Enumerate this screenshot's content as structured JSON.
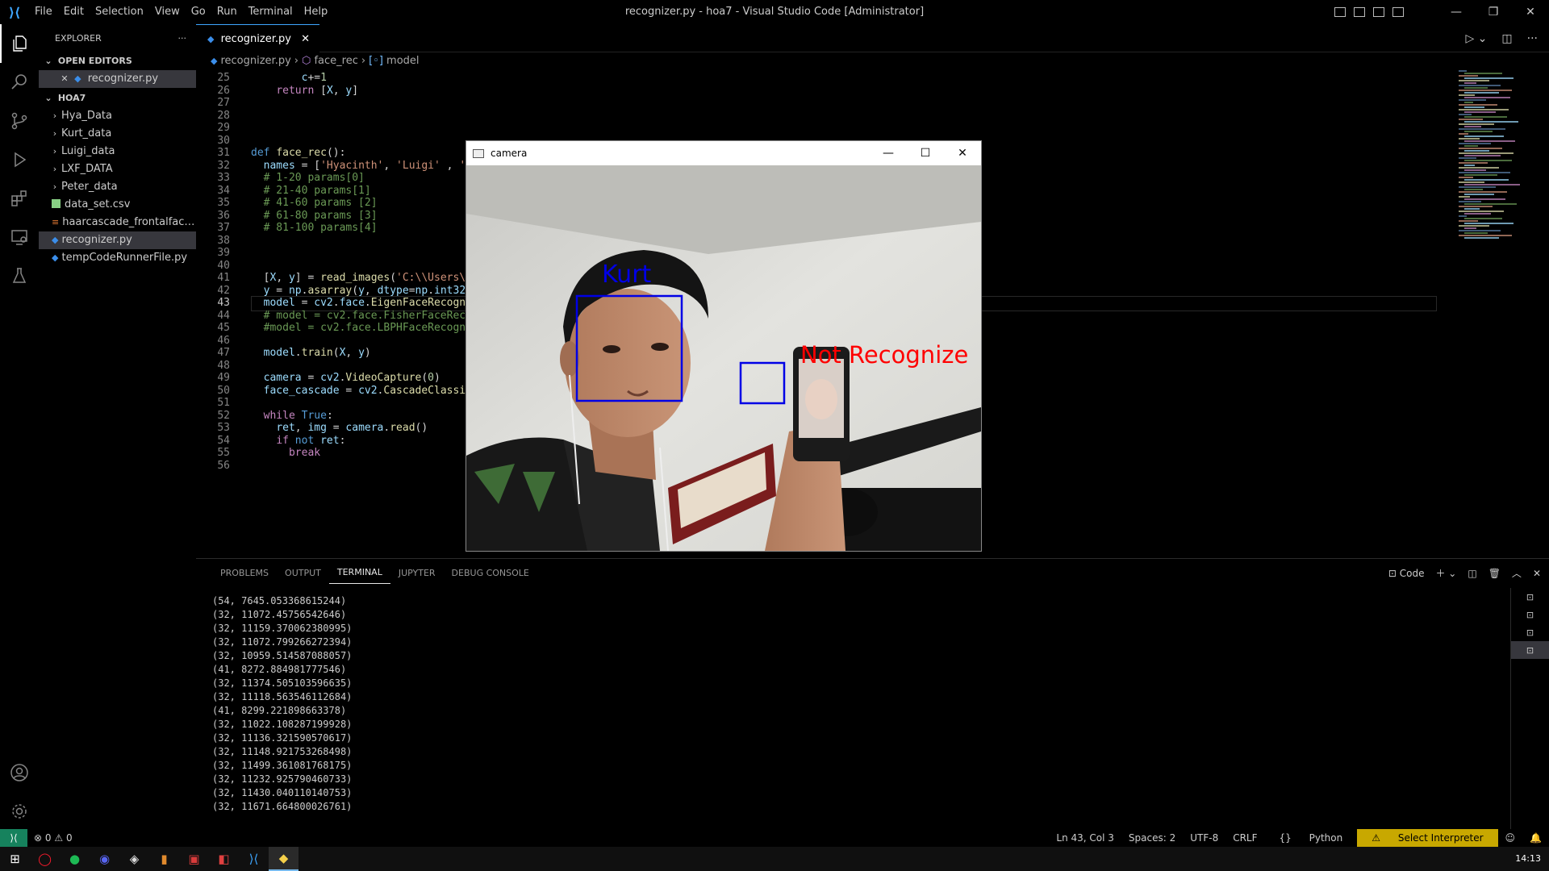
{
  "titlebar": {
    "menu": [
      "File",
      "Edit",
      "Selection",
      "View",
      "Go",
      "Run",
      "Terminal",
      "Help"
    ],
    "title": "recognizer.py - hoa7 - Visual Studio Code [Administrator]"
  },
  "explorer": {
    "header": "EXPLORER",
    "open_editors_label": "OPEN EDITORS",
    "open_editor_file": "recognizer.py",
    "folder_label": "HOA7",
    "folders": [
      "Hya_Data",
      "Kurt_data",
      "Luigi_data",
      "LXF_DATA",
      "Peter_data"
    ],
    "files": [
      "data_set.csv",
      "haarcascade_frontalface_...",
      "recognizer.py",
      "tempCodeRunnerFile.py"
    ]
  },
  "editor": {
    "tab_label": "recognizer.py",
    "breadcrumb": [
      "recognizer.py",
      "face_rec",
      "model"
    ],
    "lines": [
      {
        "n": "25",
        "text": "        c+=1"
      },
      {
        "n": "26",
        "text": "    return [X, y]"
      },
      {
        "n": "27",
        "text": ""
      },
      {
        "n": "28",
        "text": ""
      },
      {
        "n": "29",
        "text": ""
      },
      {
        "n": "30",
        "text": ""
      },
      {
        "n": "31",
        "text": "def face_rec():"
      },
      {
        "n": "32",
        "text": "  names = ['Hyacinth', 'Luigi' , 'K"
      },
      {
        "n": "33",
        "text": "  # 1-20 params[0]"
      },
      {
        "n": "34",
        "text": "  # 21-40 params[1]"
      },
      {
        "n": "35",
        "text": "  # 41-60 params [2]"
      },
      {
        "n": "36",
        "text": "  # 61-80 params [3]"
      },
      {
        "n": "37",
        "text": "  # 81-100 params[4]"
      },
      {
        "n": "38",
        "text": ""
      },
      {
        "n": "39",
        "text": ""
      },
      {
        "n": "40",
        "text": ""
      },
      {
        "n": "41",
        "text": "  [X, y] = read_images('C:\\\\Users\\\\"
      },
      {
        "n": "42",
        "text": "  y = np.asarray(y, dtype=np.int32)"
      },
      {
        "n": "43",
        "text": "  model = cv2.face.EigenFaceRecogni"
      },
      {
        "n": "44",
        "text": "  # model = cv2.face.FisherFaceReco"
      },
      {
        "n": "45",
        "text": "  #model = cv2.face.LBPHFaceRecogni"
      },
      {
        "n": "46",
        "text": ""
      },
      {
        "n": "47",
        "text": "  model.train(X, y)"
      },
      {
        "n": "48",
        "text": ""
      },
      {
        "n": "49",
        "text": "  camera = cv2.VideoCapture(0)"
      },
      {
        "n": "50",
        "text": "  face_cascade = cv2.CascadeClassif"
      },
      {
        "n": "51",
        "text": ""
      },
      {
        "n": "52",
        "text": "  while True:"
      },
      {
        "n": "53",
        "text": "    ret, img = camera.read()"
      },
      {
        "n": "54",
        "text": "    if not ret:"
      },
      {
        "n": "55",
        "text": "      break"
      },
      {
        "n": "56",
        "text": ""
      }
    ]
  },
  "camera_window": {
    "title": "camera",
    "label_recognized": "Kurt",
    "label_unrecognized": "Not Recognize"
  },
  "panel": {
    "tabs": [
      "PROBLEMS",
      "OUTPUT",
      "TERMINAL",
      "JUPYTER",
      "DEBUG CONSOLE"
    ],
    "active_tab": "TERMINAL",
    "terminal_profile": "Code",
    "terminal_lines": [
      "(54, 7645.053368615244)",
      "(32, 11072.45756542646)",
      "(32, 11159.370062380995)",
      "(32, 11072.799266272394)",
      "(32, 10959.514587088057)",
      "(41, 8272.884981777546)",
      "(32, 11374.505103596635)",
      "(32, 11118.563546112684)",
      "(41, 8299.221898663378)",
      "(32, 11022.108287199928)",
      "(32, 11136.321590570617)",
      "(32, 11148.921753268498)",
      "(32, 11499.361081768175)",
      "(32, 11232.925790460733)",
      "(32, 11430.040110140753)",
      "(32, 11671.664800026761)"
    ]
  },
  "statusbar": {
    "errors": "0",
    "warnings": "0",
    "position": "Ln 43, Col 3",
    "spaces": "Spaces: 2",
    "encoding": "UTF-8",
    "eol": "CRLF",
    "language": "Python",
    "interpreter": "Select Interpreter"
  },
  "taskbar": {
    "clock": "14:13"
  },
  "colors": {
    "accent": "#3ea6ff",
    "detect_box": "#0000e6",
    "unrecognized_text": "#ff0000",
    "warn_bg": "#c8a800"
  }
}
